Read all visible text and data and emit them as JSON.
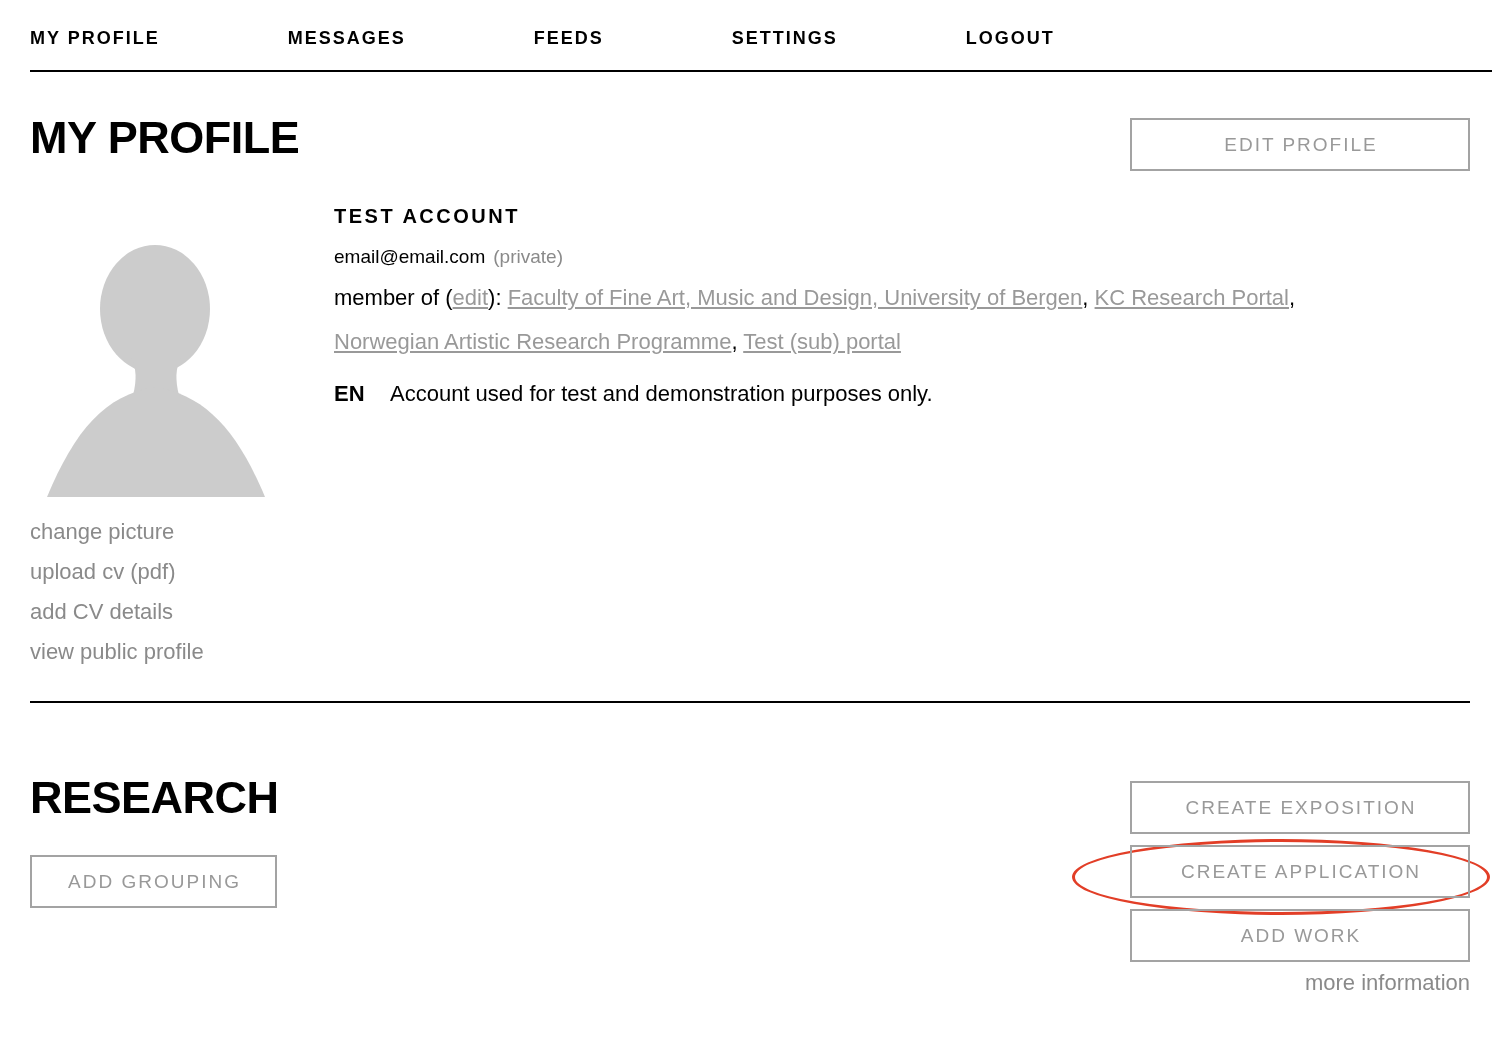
{
  "nav": [
    "MY PROFILE",
    "MESSAGES",
    "FEEDS",
    "SETTINGS",
    "LOGOUT"
  ],
  "profile": {
    "title": "MY PROFILE",
    "edit_button": "EDIT PROFILE",
    "picture_links": [
      "change picture",
      "upload cv (pdf)",
      "add CV details",
      "view public profile"
    ],
    "name": "TEST ACCOUNT",
    "email": "email@email.com",
    "email_visibility": "(private)",
    "membership": [
      {
        "kind": "text",
        "text": "member of ("
      },
      {
        "kind": "edit",
        "text": "edit"
      },
      {
        "kind": "text",
        "text": "): "
      },
      {
        "kind": "link",
        "text": "Faculty of Fine Art, Music and Design, University of Bergen"
      },
      {
        "kind": "text",
        "text": ", "
      },
      {
        "kind": "link",
        "text": "KC Research Portal"
      },
      {
        "kind": "text",
        "text": ", "
      },
      {
        "kind": "link",
        "text": "Norwegian Artistic Research Programme"
      },
      {
        "kind": "text",
        "text": ", "
      },
      {
        "kind": "link",
        "text": "Test (sub) portal"
      }
    ],
    "description": {
      "language": "EN",
      "text": "Account used for test and demonstration purposes only."
    }
  },
  "research": {
    "title": "RESEARCH",
    "grouping_button": "ADD GROUPING",
    "actions": [
      {
        "label": "CREATE EXPOSITION",
        "highlighted": false
      },
      {
        "label": "CREATE APPLICATION",
        "highlighted": true
      },
      {
        "label": "ADD WORK",
        "highlighted": false
      }
    ],
    "more_link": "more information"
  }
}
